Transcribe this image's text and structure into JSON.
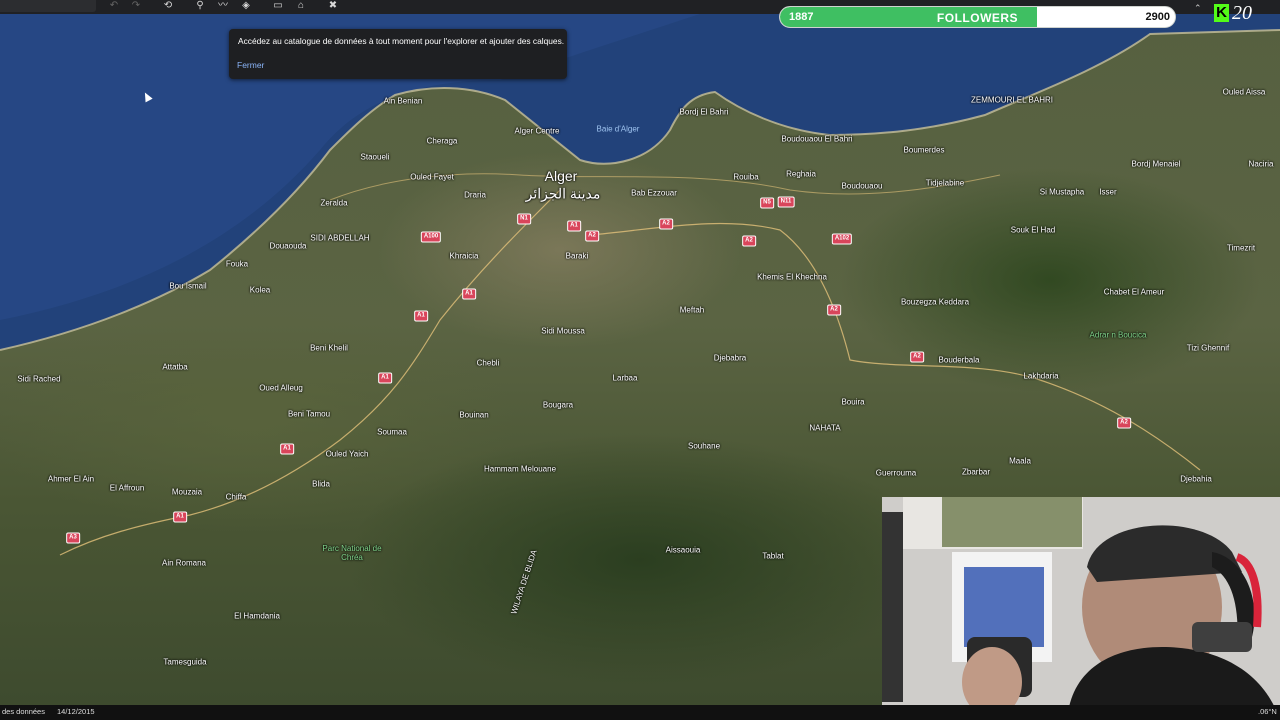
{
  "toolbar": {
    "icons": [
      "undo-icon",
      "redo-icon",
      "history-icon",
      "pin-icon",
      "path-icon",
      "layers-icon",
      "ruler-icon",
      "image-icon",
      "tools-icon"
    ]
  },
  "tooltip": {
    "text": "Accédez au catalogue de données à tout moment pour l'explorer et ajouter des calques.",
    "button": "Fermer"
  },
  "followers": {
    "current": "1887",
    "label": "FOLLOWERS",
    "goal": "2900",
    "progress_percent": 65,
    "fill_color": "#3fbf62"
  },
  "kick": {
    "logo": "K",
    "count": "20",
    "color": "#53fc18"
  },
  "map": {
    "places": [
      {
        "name": "Ain Benian"
      },
      {
        "name": "Cheraga"
      },
      {
        "name": "Alger Centre"
      },
      {
        "name": "Baie d'Alger"
      },
      {
        "name": "Bordj El Bahri"
      },
      {
        "name": "Staoueli"
      },
      {
        "name": "Ouled Fayet"
      },
      {
        "name": "Alger",
        "big": true
      },
      {
        "name": "مدينة الجزائر",
        "big": true
      },
      {
        "name": "Bab Ezzouar"
      },
      {
        "name": "Rouiba"
      },
      {
        "name": "Reghaia"
      },
      {
        "name": "Boudouaou El Bahri"
      },
      {
        "name": "Boumerdes"
      },
      {
        "name": "ZEMMOURI EL BAHRI"
      },
      {
        "name": "Ouled Aissa"
      },
      {
        "name": "Zeralda"
      },
      {
        "name": "Draria"
      },
      {
        "name": "Khraicia"
      },
      {
        "name": "Baraki"
      },
      {
        "name": "SIDI ABDELLAH"
      },
      {
        "name": "Douaouda"
      },
      {
        "name": "Fouka"
      },
      {
        "name": "Kolea"
      },
      {
        "name": "Bou Ismail"
      },
      {
        "name": "Boudouaou"
      },
      {
        "name": "Tidjelabine"
      },
      {
        "name": "Si Mustapha"
      },
      {
        "name": "Isser"
      },
      {
        "name": "Bordj Menaiel"
      },
      {
        "name": "Naciria"
      },
      {
        "name": "Souk El Had"
      },
      {
        "name": "Khemis El Khechna"
      },
      {
        "name": "Meftah"
      },
      {
        "name": "Sidi Moussa"
      },
      {
        "name": "Beni Khelil"
      },
      {
        "name": "Attatba"
      },
      {
        "name": "Sidi Rached"
      },
      {
        "name": "Chebli"
      },
      {
        "name": "Larbaa"
      },
      {
        "name": "Djebabra"
      },
      {
        "name": "Bouzegza Keddara"
      },
      {
        "name": "Timezrit"
      },
      {
        "name": "Chabet El Ameur"
      },
      {
        "name": "Adrar n Boucica",
        "park": true
      },
      {
        "name": "Tizi Ghennif"
      },
      {
        "name": "Bouderbala"
      },
      {
        "name": "Lakhdaria"
      },
      {
        "name": "Oued Alleug"
      },
      {
        "name": "Beni Tamou"
      },
      {
        "name": "Bougara"
      },
      {
        "name": "Bouinan"
      },
      {
        "name": "Soumaa"
      },
      {
        "name": "Ouled Yaich"
      },
      {
        "name": "Blida"
      },
      {
        "name": "Bouira"
      },
      {
        "name": "Souhane"
      },
      {
        "name": "NAHATA"
      },
      {
        "name": "Guerrouma"
      },
      {
        "name": "Zbarbar"
      },
      {
        "name": "Maala"
      },
      {
        "name": "Djebahia"
      },
      {
        "name": "Ahmer El Ain"
      },
      {
        "name": "El Affroun"
      },
      {
        "name": "Mouzaia"
      },
      {
        "name": "Chiffa"
      },
      {
        "name": "Hammam Melouane"
      },
      {
        "name": "Parc National de Chréa",
        "park": true
      },
      {
        "name": "Aissaouia"
      },
      {
        "name": "Tablat"
      },
      {
        "name": "Ain Romana"
      },
      {
        "name": "El Hamdania"
      },
      {
        "name": "Tamesguida"
      },
      {
        "name": "WILAYA DE BLIDA"
      }
    ],
    "shields": [
      "N1",
      "A1",
      "A2",
      "A2",
      "N5",
      "N11",
      "A102",
      "A100",
      "A1",
      "A1",
      "A1",
      "A2",
      "A2",
      "A2",
      "A1",
      "A1",
      "A3",
      "A3",
      "A2"
    ]
  },
  "status": {
    "source": "des données",
    "date": "14/12/2015",
    "coords": ".06°N"
  }
}
